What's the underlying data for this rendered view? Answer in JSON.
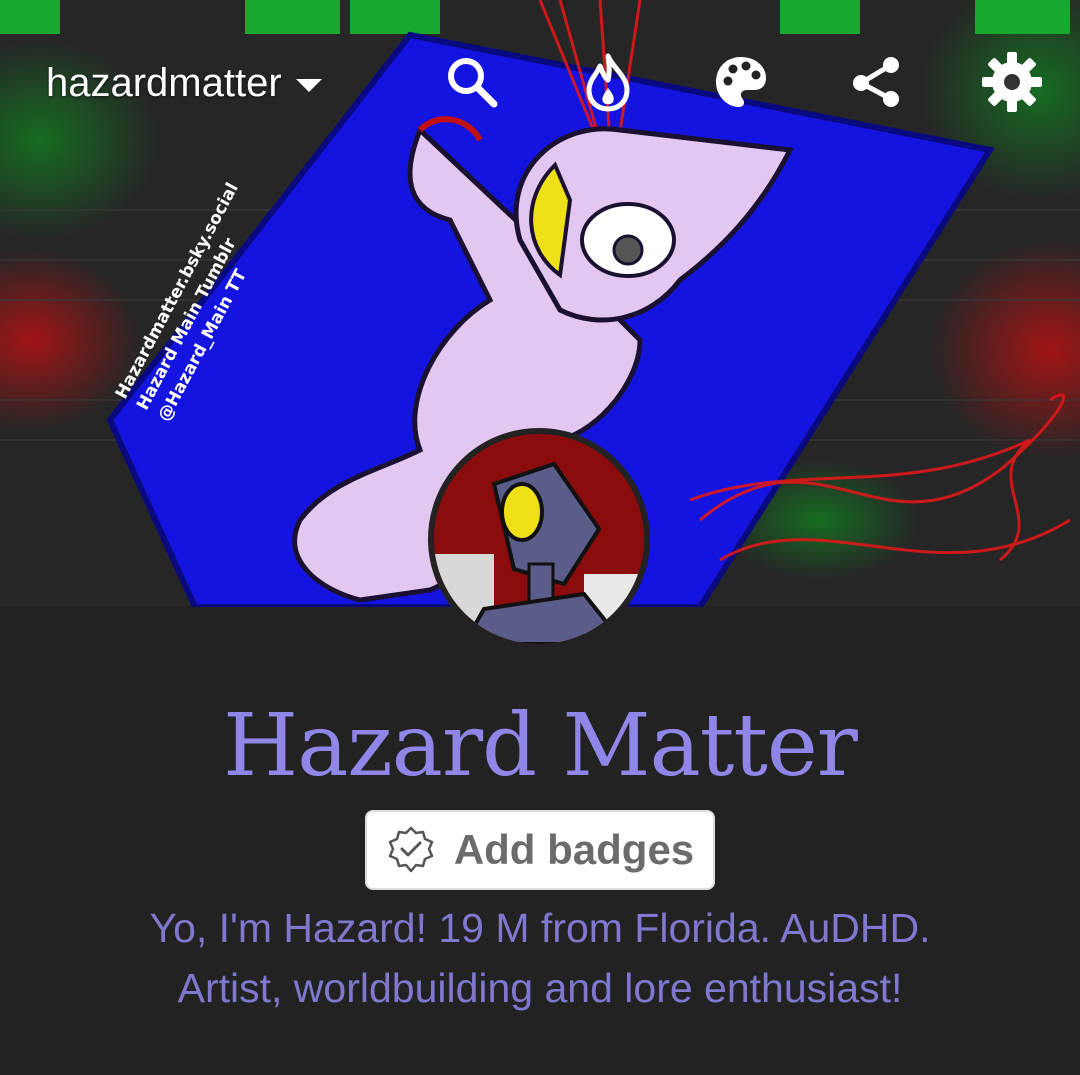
{
  "header": {
    "blog_name": "hazardmatter",
    "icons": [
      "search-icon",
      "flame-icon",
      "palette-icon",
      "share-icon",
      "gear-icon"
    ],
    "banner_text": [
      "Hazardmatter.bsky.social",
      "Hazard Main Tumblr",
      "@Hazard_Main TT"
    ]
  },
  "profile": {
    "title": "Hazard Matter",
    "badges_label": "Add badges",
    "bio_line1": "Yo, I'm Hazard! 19 M from Florida. AuDHD.",
    "bio_line2": "Artist, worldbuilding and lore enthusiast!"
  },
  "colors": {
    "background": "#222222",
    "title": "#8f86e8",
    "bio": "#7f78cf",
    "banner_blue": "#1414e0",
    "character_pink": "#e2c8f0"
  }
}
